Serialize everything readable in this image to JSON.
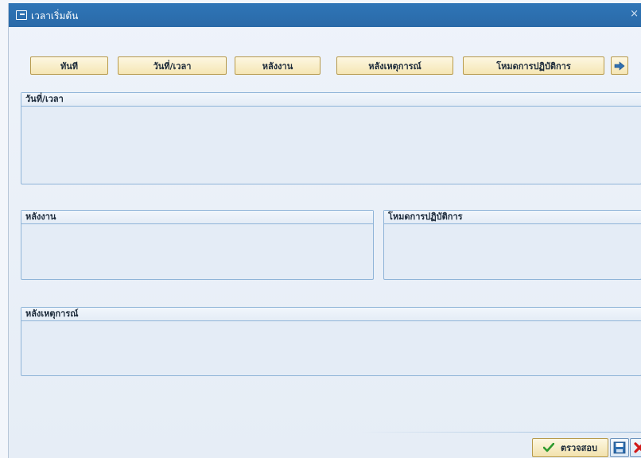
{
  "window": {
    "title": "เวลาเริ่มต้น",
    "title_icon": "window-icon",
    "close_glyph": "×"
  },
  "toolbar": {
    "buttons": [
      {
        "label": "ทันที"
      },
      {
        "label": "วันที่/เวลา"
      },
      {
        "label": "หลังงาน"
      },
      {
        "label": "หลังเหตุการณ์"
      },
      {
        "label": "โหมดการปฏิบัติการ"
      }
    ],
    "next_icon": "arrow-right-icon"
  },
  "groups": {
    "datetime": {
      "title": "วันที่/เวลา"
    },
    "after_job": {
      "title": "หลังงาน"
    },
    "operation_mode": {
      "title": "โหมดการปฏิบัติการ"
    },
    "after_event": {
      "title": "หลังเหตุการณ์"
    }
  },
  "footer": {
    "check_label": "ตรวจสอบ",
    "check_icon": "checkmark-icon",
    "save_icon": "save-icon",
    "cancel_icon": "cancel-x-icon"
  },
  "colors": {
    "title_bar": "#2a6aa8",
    "button_face": "#f5e6b5",
    "group_border": "#8fb4d8",
    "check_green": "#2e9a2e",
    "cancel_red": "#d11a1a"
  }
}
